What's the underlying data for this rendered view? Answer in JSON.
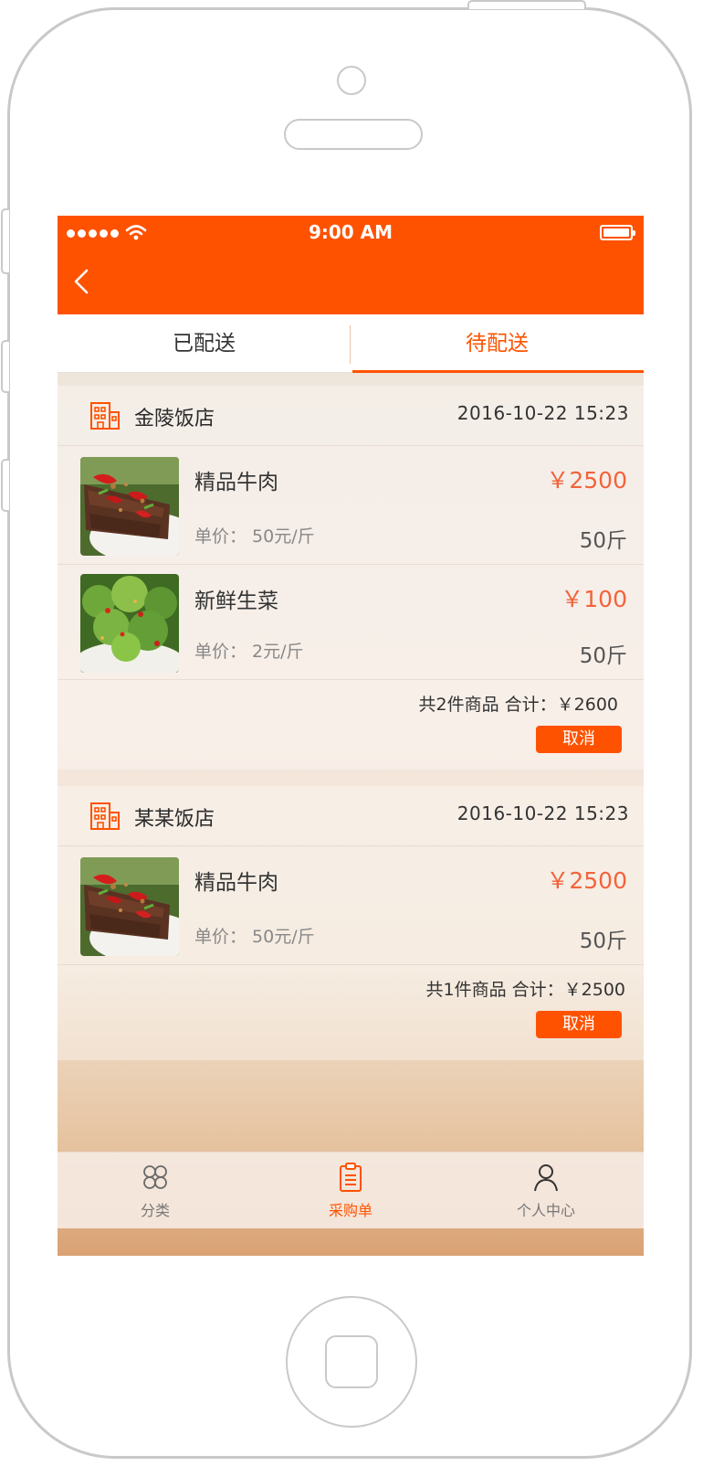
{
  "status_bar": {
    "time": "9:00 AM"
  },
  "tabs": [
    {
      "label": "已配送",
      "active": false
    },
    {
      "label": "待配送",
      "active": true
    }
  ],
  "orders": [
    {
      "shop": "金陵饭店",
      "date": "2016-10-22   15:23",
      "items": [
        {
          "name": "精品牛肉",
          "unit": "单价： 50元/斤",
          "price": "￥2500",
          "qty": "50斤",
          "image": "beef-dish"
        },
        {
          "name": "新鲜生菜",
          "unit": "单价： 2元/斤",
          "price": "￥100",
          "qty": "50斤",
          "image": "lettuce-salad"
        }
      ],
      "summary": "共2件商品  合计：￥2600",
      "cancel_label": "取消"
    },
    {
      "shop": "某某饭店",
      "date": "2016-10-22   15:23",
      "items": [
        {
          "name": "精品牛肉",
          "unit": "单价： 50元/斤",
          "price": "￥2500",
          "qty": "50斤",
          "image": "beef-dish"
        }
      ],
      "summary": "共1件商品  合计：￥2500",
      "cancel_label": "取消"
    }
  ],
  "tabbar": [
    {
      "label": "分类",
      "icon": "category-icon",
      "active": false
    },
    {
      "label": "采购单",
      "icon": "clipboard-icon",
      "active": true
    },
    {
      "label": "个人中心",
      "icon": "user-icon",
      "active": false
    }
  ],
  "colors": {
    "accent": "#fe5200",
    "price": "#f2633c"
  }
}
